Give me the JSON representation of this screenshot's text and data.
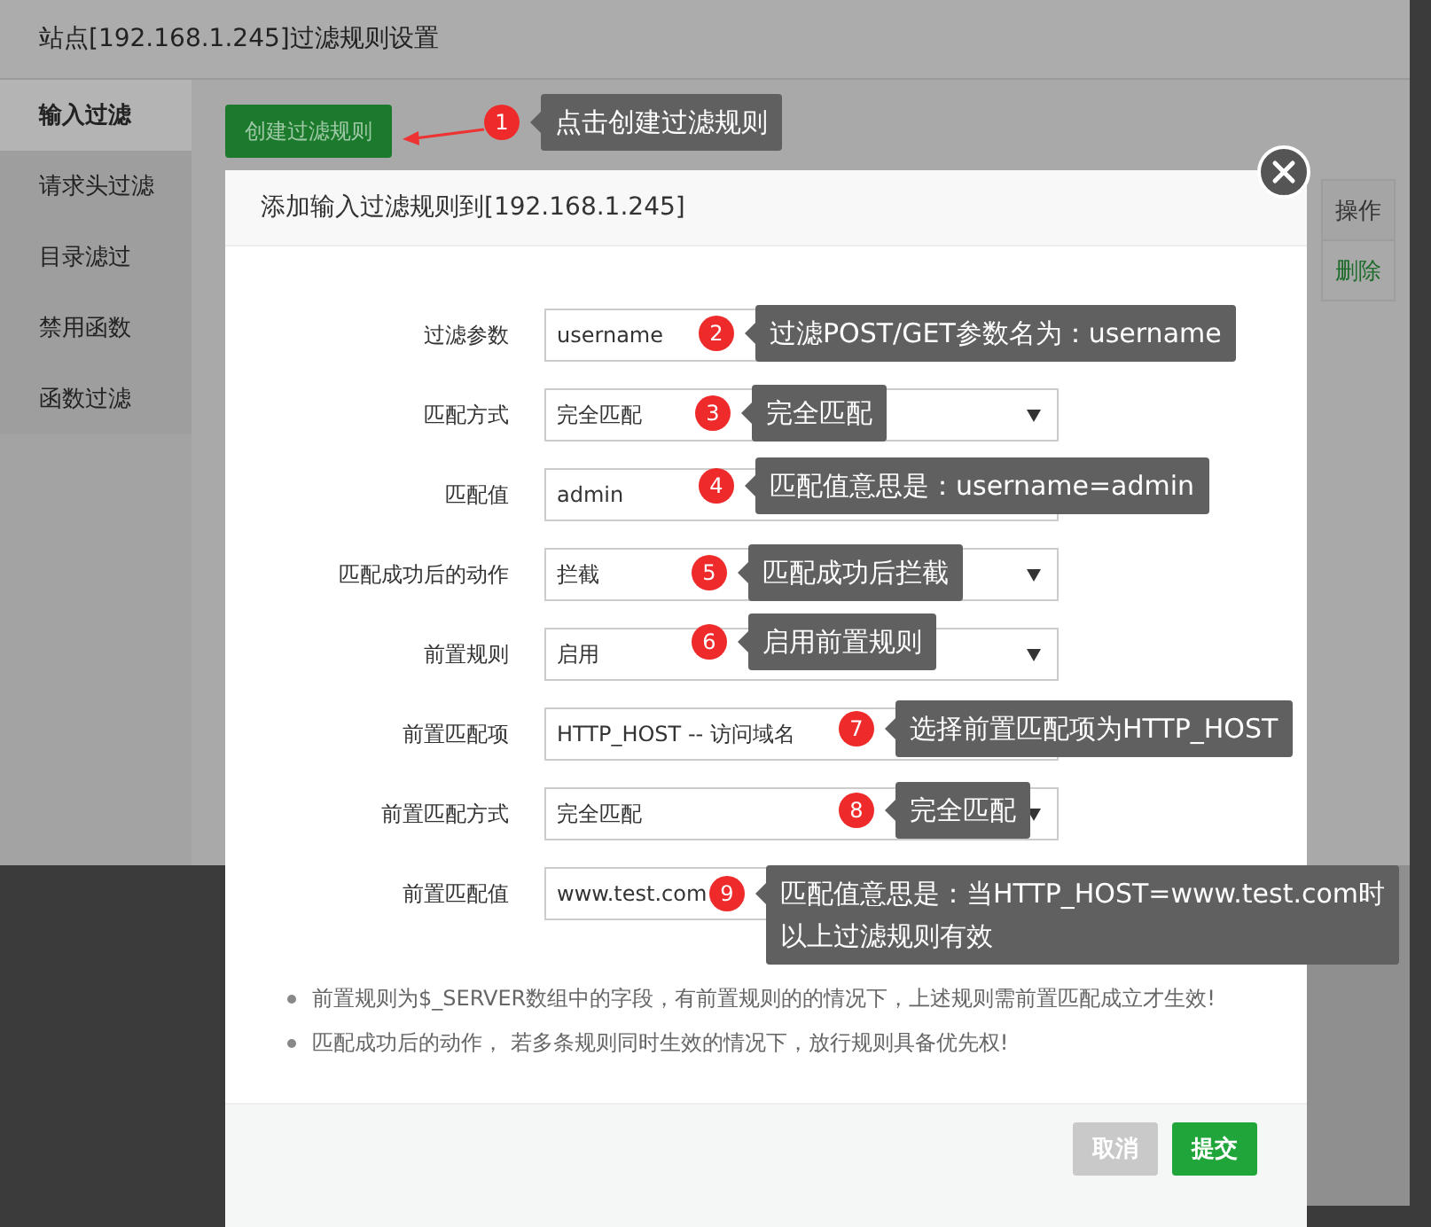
{
  "window": {
    "title": "站点[192.168.1.245]过滤规则设置"
  },
  "sidebar": {
    "items": [
      {
        "label": "输入过滤",
        "selected": true
      },
      {
        "label": "请求头过滤",
        "selected": false
      },
      {
        "label": "目录滤过",
        "selected": false
      },
      {
        "label": "禁用函数",
        "selected": false
      },
      {
        "label": "函数过滤",
        "selected": false
      }
    ]
  },
  "create_button": "创建过滤规则",
  "table": {
    "columns": [
      "操作"
    ],
    "rows": [
      {
        "action": "删除"
      }
    ]
  },
  "dialog": {
    "title": "添加输入过滤规则到[192.168.1.245]",
    "fields": [
      {
        "label": "过滤参数",
        "kind": "input",
        "value": "username"
      },
      {
        "label": "匹配方式",
        "kind": "select",
        "value": "完全匹配"
      },
      {
        "label": "匹配值",
        "kind": "input",
        "value": "admin"
      },
      {
        "label": "匹配成功后的动作",
        "kind": "select",
        "value": "拦截"
      },
      {
        "label": "前置规则",
        "kind": "select",
        "value": "启用"
      },
      {
        "label": "前置匹配项",
        "kind": "select",
        "value": "HTTP_HOST -- 访问域名"
      },
      {
        "label": "前置匹配方式",
        "kind": "select",
        "value": "完全匹配"
      },
      {
        "label": "前置匹配值",
        "kind": "input",
        "value": "www.test.com"
      }
    ],
    "notes": [
      "前置规则为$_SERVER数组中的字段，有前置规则的的情况下，上述规则需前置匹配成立才生效!",
      "匹配成功后的动作， 若多条规则同时生效的情况下，放行规则具备优先权!"
    ],
    "buttons": [
      {
        "label": "取消",
        "kind": "secondary"
      },
      {
        "label": "提交",
        "kind": "primary"
      }
    ]
  },
  "annotations": [
    {
      "number": "1",
      "lines": [
        "点击创建过滤规则"
      ]
    },
    {
      "number": "2",
      "lines": [
        "过滤POST/GET参数名为：username"
      ]
    },
    {
      "number": "3",
      "lines": [
        "完全匹配"
      ]
    },
    {
      "number": "4",
      "lines": [
        "匹配值意思是：username=admin"
      ]
    },
    {
      "number": "5",
      "lines": [
        "匹配成功后拦截"
      ]
    },
    {
      "number": "6",
      "lines": [
        "启用前置规则"
      ]
    },
    {
      "number": "7",
      "lines": [
        "选择前置匹配项为HTTP_HOST"
      ]
    },
    {
      "number": "8",
      "lines": [
        "完全匹配"
      ]
    },
    {
      "number": "9",
      "lines": [
        "匹配值意思是：当HTTP_HOST=www.test.com时",
        "以上过滤规则有效"
      ]
    }
  ]
}
